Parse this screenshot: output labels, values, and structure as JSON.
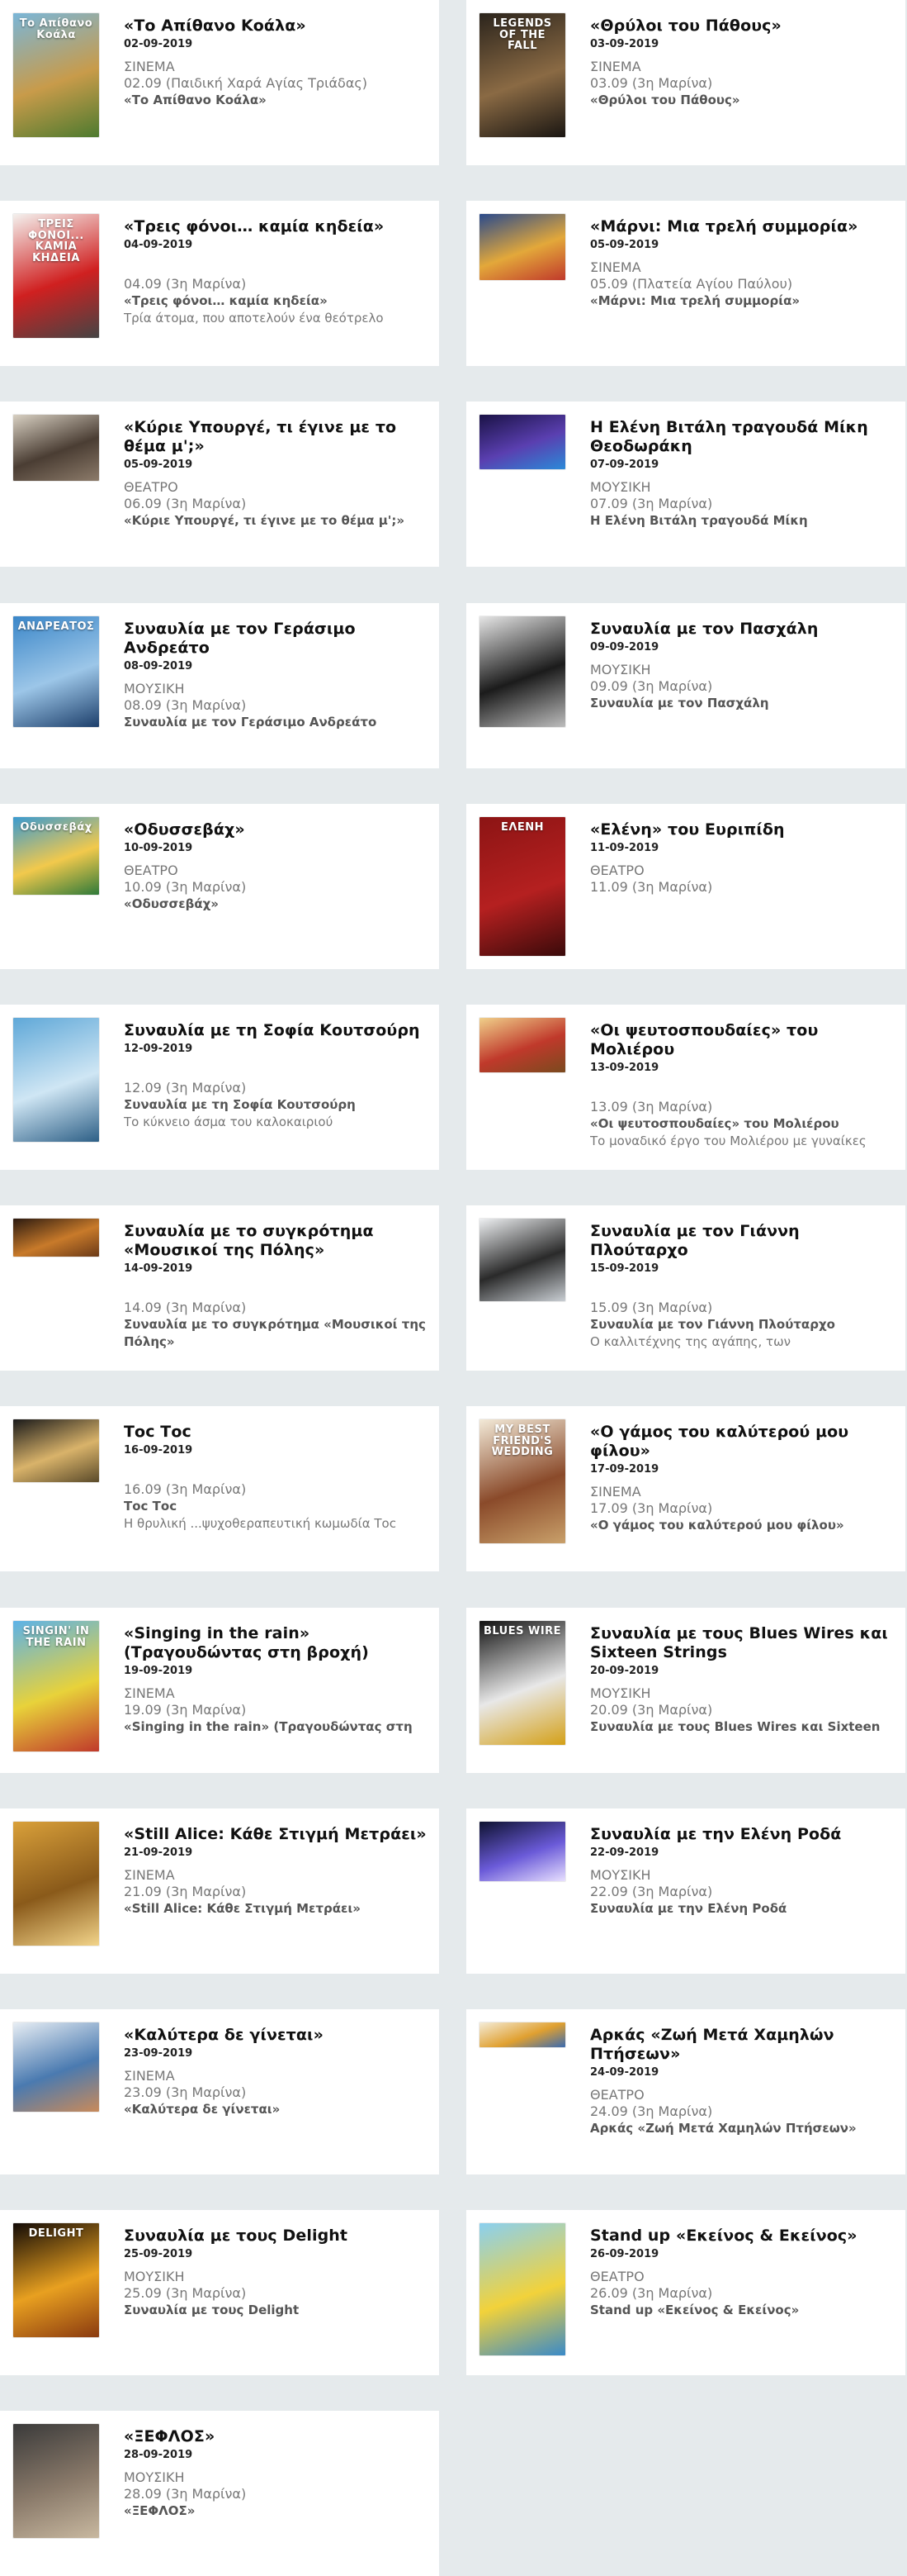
{
  "events": [
    {
      "title": "«Το Απίθανο Κοάλα»",
      "date": "02-09-2019",
      "category": "ΣΙΝΕΜΑ",
      "when": "02.09 (Παιδική Χαρά Αγίας Τριάδας)",
      "subtitle": "«Το Απίθανο Κοάλα»",
      "description": "",
      "poster_text": "Το Απίθανο Κοάλα",
      "poster_colors": [
        "#7ab6d8",
        "#c89b4a",
        "#4d7a2f"
      ]
    },
    {
      "title": "«Θρύλοι του Πάθους»",
      "date": "03-09-2019",
      "category": "ΣΙΝΕΜΑ",
      "when": "03.09 (3η Μαρίνα)",
      "subtitle": "«Θρύλοι του Πάθους»",
      "description": "",
      "poster_text": "LEGENDS OF THE FALL",
      "poster_colors": [
        "#2b241c",
        "#8a6a44",
        "#1a1612"
      ]
    },
    {
      "title": "«Τρεις φόνοι… καμία κηδεία»",
      "date": "04-09-2019",
      "category": "",
      "when": "04.09 (3η Μαρίνα)",
      "subtitle": "«Τρεις φόνοι… καμία κηδεία»",
      "description": "Τρία άτομα, που αποτελούν ένα θεότρελο",
      "poster_text": "ΤΡΕΙΣ ΦΟΝΟΙ... ΚΑΜΙΑ ΚΗΔΕΙΑ",
      "poster_colors": [
        "#f4f1ee",
        "#d02020",
        "#444444"
      ]
    },
    {
      "title": "«Μάρνι: Μια τρελή συμμορία»",
      "date": "05-09-2019",
      "category": "ΣΙΝΕΜΑ",
      "when": "05.09 (Πλατεία Αγίου Παύλου)",
      "subtitle": "«Μάρνι: Μια τρελή συμμορία»",
      "description": "",
      "poster_text": "",
      "poster_colors": [
        "#2a4a8c",
        "#e3a83a",
        "#c0392b"
      ]
    },
    {
      "title": "«Κύριε Υπουργέ, τι έγινε με το θέμα μ';»",
      "date": "05-09-2019",
      "category": "ΘΕΑΤΡΟ",
      "when": "06.09 (3η Μαρίνα)",
      "subtitle": "«Κύριε Υπουργέ, τι έγινε με το θέμα μ';»",
      "description": "",
      "poster_text": "",
      "poster_colors": [
        "#d8d0c2",
        "#4a3d33",
        "#8c7b6a"
      ]
    },
    {
      "title": "Η Ελένη Βιτάλη τραγουδά Μίκη Θεοδωράκη",
      "date": "07-09-2019",
      "category": "ΜΟΥΣΙΚΗ",
      "when": "07.09 (3η Μαρίνα)",
      "subtitle": "Η Ελένη Βιτάλη τραγουδά Μίκη",
      "description": "",
      "poster_text": "",
      "poster_colors": [
        "#1a1246",
        "#5a3fb0",
        "#2b8ad8"
      ]
    },
    {
      "title": "Συναυλία με τον Γεράσιμο Ανδρεάτο",
      "date": "08-09-2019",
      "category": "ΜΟΥΣΙΚΗ",
      "when": "08.09 (3η Μαρίνα)",
      "subtitle": "Συναυλία με τον Γεράσιμο Ανδρεάτο",
      "description": "",
      "poster_text": "ΑΝΔΡΕΑΤΟΣ",
      "poster_colors": [
        "#3a86c8",
        "#9cc6e8",
        "#1d3f6b"
      ]
    },
    {
      "title": "Συναυλία με τον Πασχάλη",
      "date": "09-09-2019",
      "category": "ΜΟΥΣΙΚΗ",
      "when": "09.09 (3η Μαρίνα)",
      "subtitle": "Συναυλία με τον Πασχάλη",
      "description": "",
      "poster_text": "",
      "poster_colors": [
        "#e6e6e6",
        "#1b1b1b",
        "#bdbdbd"
      ]
    },
    {
      "title": "«Οδυσσεβάχ»",
      "date": "10-09-2019",
      "category": "ΘΕΑΤΡΟ",
      "when": "10.09 (3η Μαρίνα)",
      "subtitle": "«Οδυσσεβάχ»",
      "description": "",
      "poster_text": "Οδυσσεβάχ",
      "poster_colors": [
        "#3a9ad0",
        "#f2c94c",
        "#2f7a3a"
      ]
    },
    {
      "title": "«Ελένη» του Ευριπίδη",
      "date": "11-09-2019",
      "category": "ΘΕΑΤΡΟ",
      "when": "11.09 (3η Μαρίνα)",
      "subtitle": "",
      "description": "",
      "poster_text": "ΕΛΕΝΗ",
      "poster_colors": [
        "#8c1414",
        "#b52020",
        "#3a0a0a"
      ]
    },
    {
      "title": "Συναυλία με τη Σοφία Κουτσούρη",
      "date": "12-09-2019",
      "category": "",
      "when": "12.09 (3η Μαρίνα)",
      "subtitle": "Συναυλία με τη Σοφία Κουτσούρη",
      "description": "Το κύκνειο άσμα του καλοκαιριού",
      "poster_text": "",
      "poster_colors": [
        "#5fa8d8",
        "#cfe6f4",
        "#2d5f86"
      ]
    },
    {
      "title": "«Οι ψευτοσπουδαίες» του Μολιέρου",
      "date": "13-09-2019",
      "category": "",
      "when": "13.09 (3η Μαρίνα)",
      "subtitle": "«Οι ψευτοσπουδαίες» του Μολιέρου",
      "description": "Το μοναδικό έργο του Μολιέρου με γυναίκες",
      "poster_text": "",
      "poster_colors": [
        "#f0d08a",
        "#c0392b",
        "#7a4a1e"
      ]
    },
    {
      "title": "Συναυλία με το συγκρότημα «Μουσικοί της Πόλης»",
      "date": "14-09-2019",
      "category": "",
      "when": "14.09 (3η Μαρίνα)",
      "subtitle": "Συναυλία με το συγκρότημα «Μουσικοί της Πόλης»",
      "description": "",
      "poster_text": "",
      "poster_colors": [
        "#2b1a10",
        "#c87a2a",
        "#6b3a18"
      ]
    },
    {
      "title": "Συναυλία με τον Γιάννη Πλούταρχο",
      "date": "15-09-2019",
      "category": "",
      "when": "15.09 (3η Μαρίνα)",
      "subtitle": "Συναυλία με τον Γιάννη Πλούταρχο",
      "description": "Ο καλλιτέχνης της αγάπης, των",
      "poster_text": "",
      "poster_colors": [
        "#eef0f2",
        "#2a2a2a",
        "#c9ced3"
      ]
    },
    {
      "title": "Τοc Τοc",
      "date": "16-09-2019",
      "category": "",
      "when": "16.09 (3η Μαρίνα)",
      "subtitle": "Τοc Τοc",
      "description": "Η θρυλική ...ψυχοθεραπευτική κωμωδία Τοc",
      "poster_text": "",
      "poster_colors": [
        "#1a1a1a",
        "#d9b36a",
        "#5a4a2a"
      ]
    },
    {
      "title": "«Ο γάμος του καλύτερού μου φίλου»",
      "date": "17-09-2019",
      "category": "ΣΙΝΕΜΑ",
      "when": "17.09 (3η Μαρίνα)",
      "subtitle": "«Ο γάμος του καλύτερού μου φίλου»",
      "description": "",
      "poster_text": "MY BEST FRIEND'S WEDDING",
      "poster_colors": [
        "#f3ead8",
        "#8a4a2a",
        "#c9a06a"
      ]
    },
    {
      "title": "«Singing in the rain» (Τραγουδώντας στη βροχή)",
      "date": "19-09-2019",
      "category": "ΣΙΝΕΜΑ",
      "when": "19.09 (3η Μαρίνα)",
      "subtitle": "«Singing in the rain» (Τραγουδώντας στη",
      "description": "",
      "poster_text": "SINGIN' IN THE RAIN",
      "poster_colors": [
        "#5cb2e8",
        "#e8d23a",
        "#c0392b"
      ]
    },
    {
      "title": "Συναυλία με τους Blues Wires και Sixteen Strings",
      "date": "20-09-2019",
      "category": "ΜΟΥΣΙΚΗ",
      "when": "20.09 (3η Μαρίνα)",
      "subtitle": "Συναυλία με τους Blues Wires και Sixteen",
      "description": "",
      "poster_text": "BLUES WIRE",
      "poster_colors": [
        "#111111",
        "#e8e8e8",
        "#d4a017"
      ]
    },
    {
      "title": "«Still Alice: Κάθε Στιγμή Μετράει»",
      "date": "21-09-2019",
      "category": "ΣΙΝΕΜΑ",
      "when": "21.09 (3η Μαρίνα)",
      "subtitle": "«Still Alice: Κάθε Στιγμή Μετράει»",
      "description": "",
      "poster_text": "",
      "poster_colors": [
        "#d9a03a",
        "#8a5a1a",
        "#f2d48a"
      ]
    },
    {
      "title": "Συναυλία με την Ελένη Ροδά",
      "date": "22-09-2019",
      "category": "ΜΟΥΣΙΚΗ",
      "when": "22.09 (3η Μαρίνα)",
      "subtitle": "Συναυλία με την Ελένη Ροδά",
      "description": "",
      "poster_text": "",
      "poster_colors": [
        "#0e1230",
        "#6a5ad8",
        "#e8e0ff"
      ]
    },
    {
      "title": "«Καλύτερα δε γίνεται»",
      "date": "23-09-2019",
      "category": "ΣΙΝΕΜΑ",
      "when": "23.09 (3η Μαρίνα)",
      "subtitle": "«Καλύτερα δε γίνεται»",
      "description": "",
      "poster_text": "",
      "poster_colors": [
        "#e8eef4",
        "#4a7ab0",
        "#c98a5a"
      ]
    },
    {
      "title": "Αρκάς «Ζωή Μετά Χαμηλών Πτήσεων»",
      "date": "24-09-2019",
      "category": "ΘΕΑΤΡΟ",
      "when": "24.09 (3η Μαρίνα)",
      "subtitle": "Αρκάς «Ζωή Μετά Χαμηλών Πτήσεων»",
      "description": "",
      "poster_text": "",
      "poster_colors": [
        "#f4ecd8",
        "#e0a030",
        "#3a6ab0"
      ]
    },
    {
      "title": "Συναυλία με τους Delight",
      "date": "25-09-2019",
      "category": "ΜΟΥΣΙΚΗ",
      "when": "25.09 (3η Μαρίνα)",
      "subtitle": "Συναυλία με τους Delight",
      "description": "",
      "poster_text": "DELIGHT",
      "poster_colors": [
        "#120a06",
        "#e8a020",
        "#8a3a10"
      ]
    },
    {
      "title": "Stand up «Εκείνος & Εκείνος»",
      "date": "26-09-2019",
      "category": "ΘΕΑΤΡΟ",
      "when": "26.09 (3η Μαρίνα)",
      "subtitle": "Stand up «Εκείνος & Εκείνος»",
      "description": "",
      "poster_text": "",
      "poster_colors": [
        "#8ad0f0",
        "#f2d23a",
        "#3a8ac8"
      ]
    },
    {
      "title": "«ΞΕΦΛΟΣ»",
      "date": "28-09-2019",
      "category": "ΜΟΥΣΙΚΗ",
      "when": "28.09 (3η Μαρίνα)",
      "subtitle": "«ΞΕΦΛΟΣ»",
      "description": "",
      "poster_text": "",
      "poster_colors": [
        "#3a3a3a",
        "#8a7a6a",
        "#c8b8a0"
      ]
    }
  ]
}
